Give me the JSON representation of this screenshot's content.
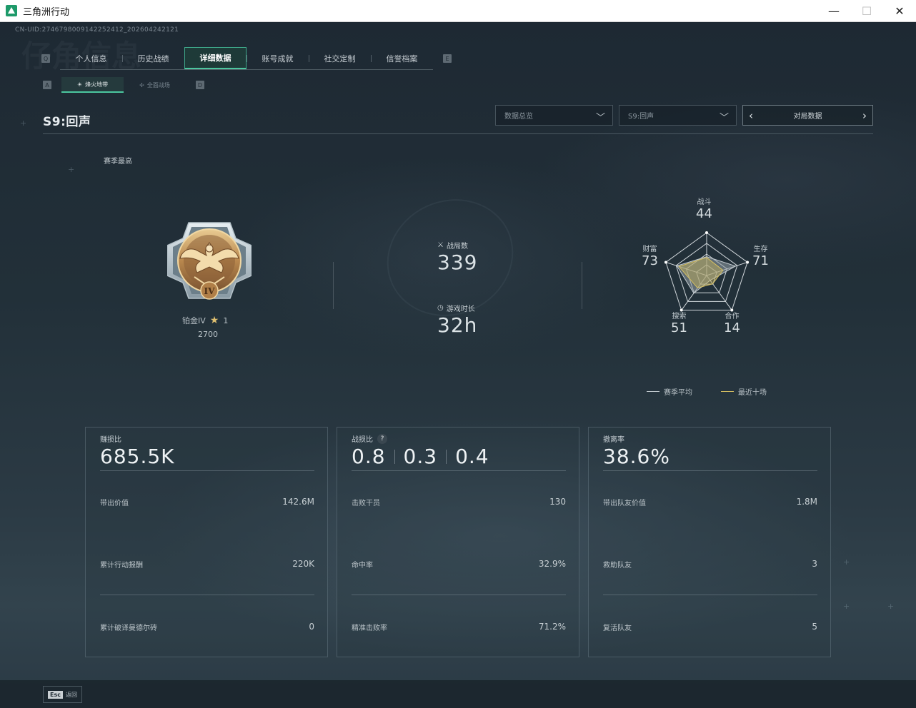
{
  "window": {
    "title": "三角洲行动",
    "minimize": "—",
    "maximize": "☐",
    "close": "✕"
  },
  "uid": "CN-UID:2746798009142252412_202604242121",
  "watermark_title": "仔角信息",
  "tabs": {
    "left_key": "Q",
    "right_key": "E",
    "items": [
      {
        "label": "个人信息"
      },
      {
        "label": "历史战绩"
      },
      {
        "label": "详细数据",
        "active": true
      },
      {
        "label": "账号成就"
      },
      {
        "label": "社交定制"
      },
      {
        "label": "信誉档案"
      }
    ]
  },
  "subtabs": {
    "left_key": "A",
    "right_key": "D",
    "items": [
      {
        "label": "烽火地带",
        "active": true
      },
      {
        "label": "全面战场"
      }
    ]
  },
  "season": {
    "title": "S9:回声",
    "best_label": "赛季最高"
  },
  "filters": {
    "overview": "数据总览",
    "season_select": "S9:回声",
    "pager_label": "对局数据"
  },
  "rank": {
    "name": "铂金IV",
    "stars": "1",
    "score": "2700",
    "badge_numeral": "IV"
  },
  "summary": {
    "matches_label": "战局数",
    "matches_value": "339",
    "time_label": "游戏时长",
    "time_value": "32h"
  },
  "radar": {
    "axes": [
      {
        "name": "战斗",
        "value": "44"
      },
      {
        "name": "生存",
        "value": "71"
      },
      {
        "name": "合作",
        "value": "14"
      },
      {
        "name": "搜索",
        "value": "51"
      },
      {
        "name": "财富",
        "value": "73"
      }
    ],
    "season_avg": [
      44,
      71,
      14,
      51,
      73
    ],
    "recent": [
      42,
      40,
      24,
      36,
      68
    ],
    "legend_avg": "赛季平均",
    "legend_recent": "最近十场",
    "color_avg": "#c4ccd1",
    "color_recent": "#d6c061"
  },
  "cards": [
    {
      "head": "赚损比",
      "big": "685.5K",
      "rows": [
        {
          "label": "带出价值",
          "value": "142.6M"
        },
        {
          "label": "累计行动报酬",
          "value": "220K"
        },
        {
          "label": "累计破译曼德尔砖",
          "value": "0"
        }
      ]
    },
    {
      "head": "战损比",
      "help": "?",
      "bigs": [
        "0.8",
        "0.3",
        "0.4"
      ],
      "rows": [
        {
          "label": "击败干员",
          "value": "130"
        },
        {
          "label": "命中率",
          "value": "32.9%"
        },
        {
          "label": "精准击败率",
          "value": "71.2%"
        }
      ]
    },
    {
      "head": "撤离率",
      "big": "38.6%",
      "rows": [
        {
          "label": "带出队友价值",
          "value": "1.8M"
        },
        {
          "label": "救助队友",
          "value": "3"
        },
        {
          "label": "复活队友",
          "value": "5"
        }
      ]
    }
  ],
  "footer": {
    "esc_key": "Esc",
    "esc_label": "返回"
  }
}
